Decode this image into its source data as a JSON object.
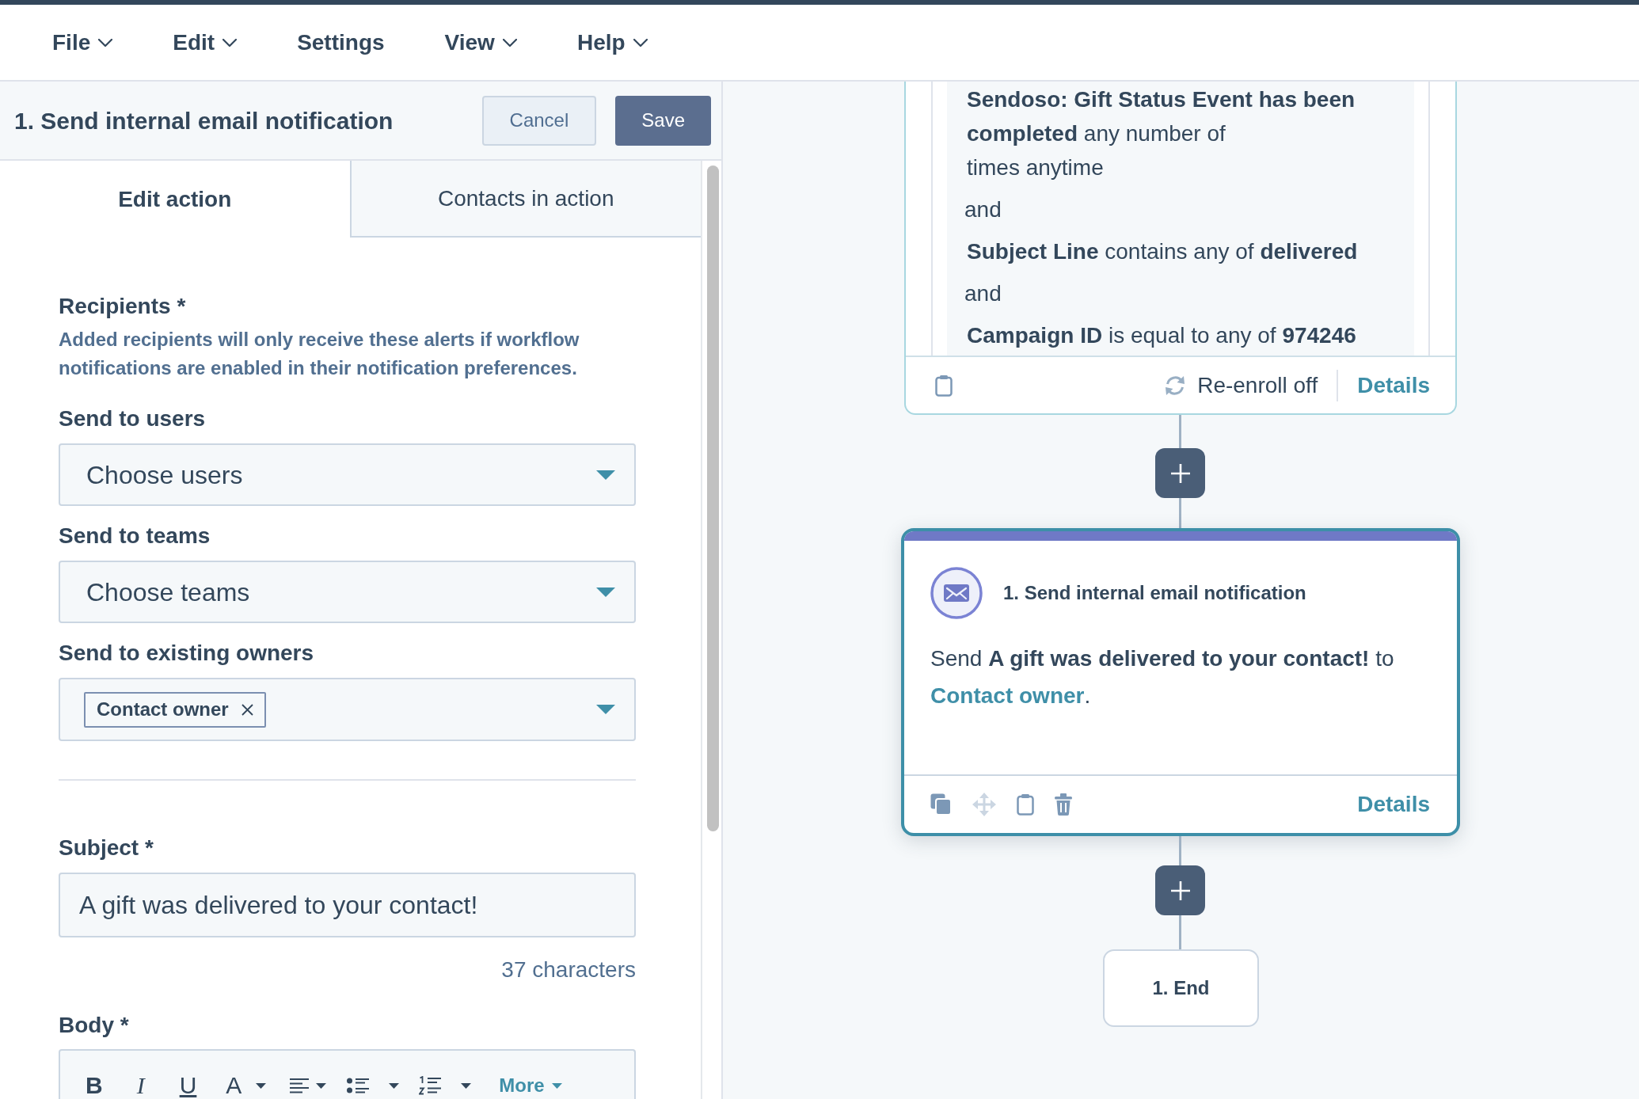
{
  "menu": [
    {
      "label": "File",
      "dropdown": true
    },
    {
      "label": "Edit",
      "dropdown": true
    },
    {
      "label": "Settings",
      "dropdown": false
    },
    {
      "label": "View",
      "dropdown": true
    },
    {
      "label": "Help",
      "dropdown": true
    }
  ],
  "panel": {
    "title": "1. Send internal email notification",
    "buttons": [
      {
        "label": "Cancel",
        "kind": "secondary"
      },
      {
        "label": "Save",
        "kind": "primary"
      }
    ],
    "tabs": [
      {
        "label": "Edit action",
        "selected": true
      },
      {
        "label": "Contacts in action",
        "selected": false
      }
    ],
    "recipients": {
      "label": "Recipients *",
      "help": "Added recipients will only receive these alerts if workflow notifications are enabled in their notification preferences."
    },
    "fields": [
      {
        "kind": "select",
        "label": "Send to users",
        "placeholder": "Choose users"
      },
      {
        "kind": "select",
        "label": "Send to teams",
        "placeholder": "Choose teams"
      },
      {
        "kind": "tags",
        "label": "Send to existing owners",
        "tags": [
          "Contact owner"
        ]
      }
    ],
    "subject": {
      "label": "Subject *",
      "value": "A gift was delivered to your contact!",
      "count": "37 characters"
    },
    "body": {
      "label": "Body *",
      "toolbar": [
        {
          "kind": "bold",
          "label": "B",
          "dropdown": false
        },
        {
          "kind": "italic",
          "label": "I",
          "dropdown": false
        },
        {
          "kind": "underline",
          "label": "U",
          "dropdown": false
        },
        {
          "kind": "text_color",
          "label": "A",
          "dropdown": true
        },
        {
          "kind": "align",
          "dropdown": true
        },
        {
          "kind": "bullets",
          "dropdown": true
        },
        {
          "kind": "numbers",
          "dropdown": true
        },
        {
          "kind": "more",
          "label": "More",
          "dropdown": true
        }
      ]
    }
  },
  "canvas": {
    "trigger_card": {
      "selected": false,
      "conditions": [
        {
          "kind": "filter",
          "text": "**Sendoso: Gift Status Event has been completed** any number of",
          "detail": "times anytime"
        },
        {
          "kind": "joiner",
          "text": "and"
        },
        {
          "kind": "filter",
          "text": "**Subject Line** contains any of **delivered**"
        },
        {
          "kind": "joiner",
          "text": "and"
        },
        {
          "kind": "filter",
          "text": "**Campaign ID** is equal to any of **974246**"
        }
      ],
      "actions": [
        {
          "kind": "paste",
          "disabled": false
        }
      ],
      "reenroll": "Re-enroll off",
      "details": "Details"
    },
    "action_card": {
      "selected": true,
      "title": "1. Send internal email notification",
      "summary": "Send **A gift was delivered to your contact!** to",
      "link": "Contact owner",
      "summary_end": ".",
      "actions": [
        {
          "kind": "copy",
          "disabled": false
        },
        {
          "kind": "move",
          "disabled": true
        },
        {
          "kind": "paste",
          "disabled": false
        },
        {
          "kind": "delete",
          "disabled": false
        }
      ],
      "details": "Details"
    },
    "end_node": {
      "label": "1. End"
    }
  }
}
